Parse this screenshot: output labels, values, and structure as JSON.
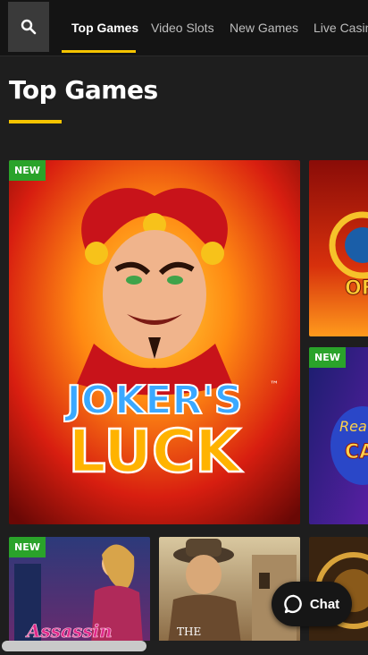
{
  "nav": {
    "tabs": [
      {
        "label": "Top Games",
        "active": true
      },
      {
        "label": "Video Slots",
        "active": false
      },
      {
        "label": "New Games",
        "active": false
      },
      {
        "label": "Live Casino",
        "active": false
      }
    ]
  },
  "section": {
    "title": "Top Games"
  },
  "tiles": [
    {
      "logo_line1": "JOKER'S",
      "logo_line2": "LUCK",
      "tm": "™",
      "badge": "NEW"
    },
    {
      "logo_line1": "OF",
      "badge": ""
    },
    {
      "logo_line1": "Rea",
      "logo_line2": "CA",
      "badge": "NEW"
    },
    {
      "logo_line1": "Assassin",
      "badge": "NEW"
    },
    {
      "logo_line1": "THE",
      "badge": ""
    },
    {
      "badge": ""
    }
  ],
  "chat": {
    "label": "Chat"
  },
  "colors": {
    "accent": "#f5c400",
    "badge": "#2aa32a",
    "background": "#1e1e1e",
    "nav": "#141414"
  },
  "icons": {
    "search": "search-icon",
    "chat": "chat-bubble-icon"
  }
}
